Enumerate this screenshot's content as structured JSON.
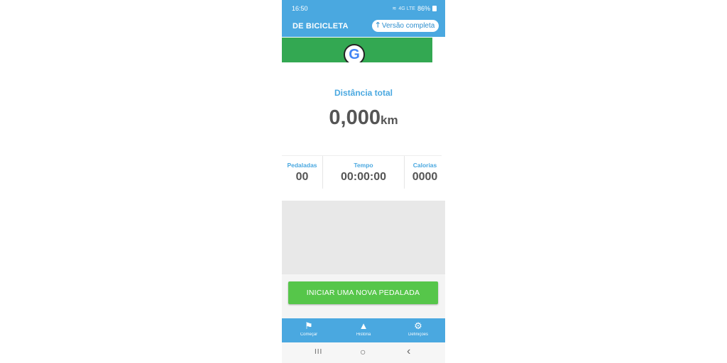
{
  "status_bar": {
    "time": "16:50",
    "signal": "4G LTE",
    "battery": "86%"
  },
  "app_bar": {
    "title": "DE BICICLETA",
    "upgrade_label": "Versão completa",
    "upgrade_icon": "arrow-up-icon"
  },
  "ad": {
    "logo_letter": "G",
    "brand_color": "#33a852"
  },
  "distance": {
    "label": "Distância total",
    "value": "0,000",
    "unit": "km"
  },
  "stats": [
    {
      "label": "Pedaladas",
      "value": "00"
    },
    {
      "label": "Tempo",
      "value": "00:00:00"
    },
    {
      "label": "Calorias",
      "value": "0000"
    }
  ],
  "start_button": {
    "label": "INICIAR UMA NOVA PEDALADA",
    "color": "#56c64a"
  },
  "bottom_nav": [
    {
      "label": "Começar",
      "icon": "flag-icon"
    },
    {
      "label": "História",
      "icon": "road-icon"
    },
    {
      "label": "Definições",
      "icon": "gear-icon"
    }
  ],
  "system_nav": {
    "recents": "III",
    "home": "○",
    "back": "‹"
  },
  "colors": {
    "accent": "#4aa8e0",
    "text_dark": "#555555"
  }
}
